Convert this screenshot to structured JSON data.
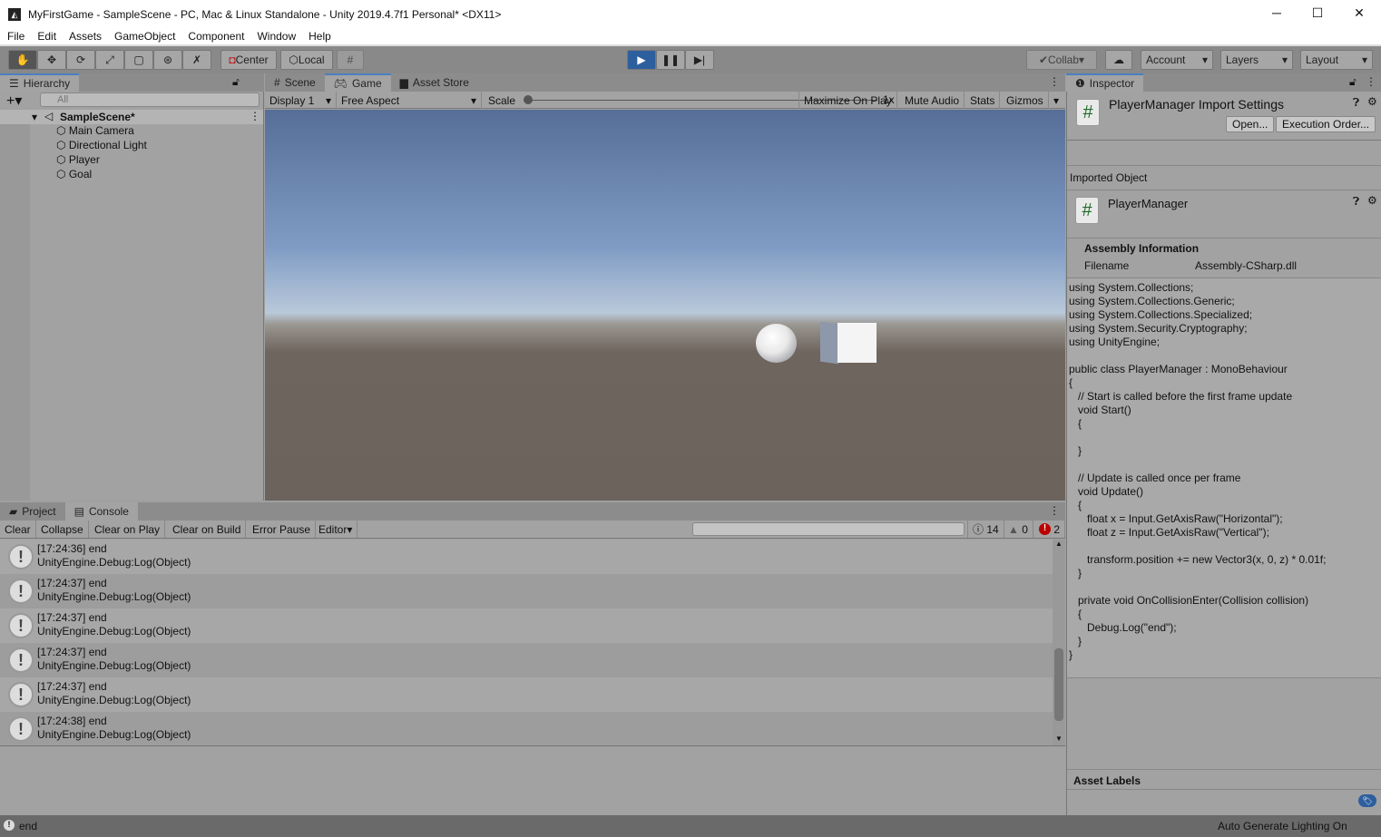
{
  "window": {
    "title": "MyFirstGame - SampleScene - PC, Mac & Linux Standalone - Unity 2019.4.7f1 Personal* <DX11>",
    "minimize": "─",
    "maximize": "☐",
    "close": "✕"
  },
  "menu": [
    "File",
    "Edit",
    "Assets",
    "GameObject",
    "Component",
    "Window",
    "Help"
  ],
  "toolbar": {
    "center": "Center",
    "local": "Local",
    "collab": "Collab",
    "account": "Account",
    "layers": "Layers",
    "layout": "Layout",
    "accent": "#2d5f9e"
  },
  "hierarchy": {
    "tab": "Hierarchy",
    "search_placeholder": "All",
    "scene": "SampleScene*",
    "items": [
      "Main Camera",
      "Directional Light",
      "Player",
      "Goal"
    ]
  },
  "game": {
    "tabs": [
      "Scene",
      "Game",
      "Asset Store"
    ],
    "display": "Display 1",
    "aspect": "Free Aspect",
    "scale_label": "Scale",
    "scale_value": "1x",
    "buttons": [
      "Maximize On Play",
      "Mute Audio",
      "Stats",
      "Gizmos"
    ]
  },
  "console": {
    "tabs": [
      "Project",
      "Console"
    ],
    "buttons": [
      "Clear",
      "Collapse",
      "Clear on Play",
      "Clear on Build",
      "Error Pause",
      "Editor"
    ],
    "log_count": "14",
    "warn_count": "0",
    "error_count": "2",
    "rows": [
      {
        "msg": "[17:24:36] end",
        "trace": "UnityEngine.Debug:Log(Object)"
      },
      {
        "msg": "[17:24:37] end",
        "trace": "UnityEngine.Debug:Log(Object)"
      },
      {
        "msg": "[17:24:37] end",
        "trace": "UnityEngine.Debug:Log(Object)"
      },
      {
        "msg": "[17:24:37] end",
        "trace": "UnityEngine.Debug:Log(Object)"
      },
      {
        "msg": "[17:24:37] end",
        "trace": "UnityEngine.Debug:Log(Object)"
      },
      {
        "msg": "[17:24:38] end",
        "trace": "UnityEngine.Debug:Log(Object)"
      }
    ]
  },
  "inspector": {
    "tab": "Inspector",
    "title": "PlayerManager Import Settings",
    "open": "Open...",
    "exec_order": "Execution Order...",
    "imported_object": "Imported Object",
    "object_name": "PlayerManager",
    "assembly_info": "Assembly Information",
    "filename_label": "Filename",
    "filename_value": "Assembly-CSharp.dll",
    "asset_labels": "Asset Labels",
    "code": [
      "using System.Collections;",
      "using System.Collections.Generic;",
      "using System.Collections.Specialized;",
      "using System.Security.Cryptography;",
      "using UnityEngine;",
      "",
      "public class PlayerManager : MonoBehaviour",
      "{",
      "   // Start is called before the first frame update",
      "   void Start()",
      "   {",
      "",
      "   }",
      "",
      "   // Update is called once per frame",
      "   void Update()",
      "   {",
      "      float x = Input.GetAxisRaw(\"Horizontal\");",
      "      float z = Input.GetAxisRaw(\"Vertical\");",
      "",
      "      transform.position += new Vector3(x, 0, z) * 0.01f;",
      "   }",
      "",
      "   private void OnCollisionEnter(Collision collision)",
      "   {",
      "      Debug.Log(\"end\");",
      "   }",
      "}"
    ]
  },
  "status": {
    "message": "end",
    "lighting": "Auto Generate Lighting On"
  }
}
